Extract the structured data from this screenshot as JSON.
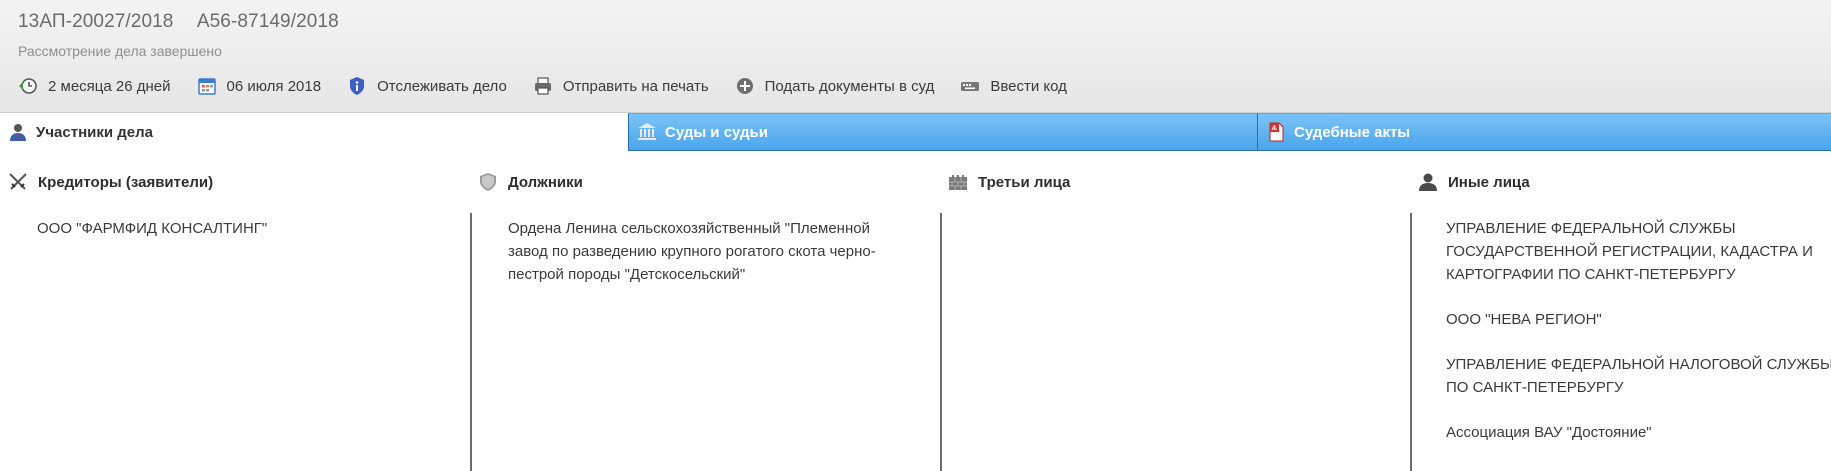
{
  "header": {
    "case_number": "13АП-20027/2018",
    "case_number_alt": "А56-87149/2018",
    "status": "Рассмотрение дела завершено"
  },
  "toolbar": {
    "duration": "2 месяца 26 дней",
    "date": "06 июля 2018",
    "track": "Отслеживать дело",
    "print": "Отправить на печать",
    "submit": "Подать документы в суд",
    "code": "Ввести код"
  },
  "tabs": {
    "participants": "Участники дела",
    "courts": "Суды и судьи",
    "acts": "Судебные акты"
  },
  "columns": {
    "creditors": {
      "title": "Кредиторы (заявители)",
      "items": [
        "ООО \"ФАРМФИД КОНСАЛТИНГ\""
      ]
    },
    "debtors": {
      "title": "Должники",
      "items": [
        "Ордена Ленина сельскохозяйственный \"Племенной завод по разведению крупного рогатого скота черно-пестрой породы \"Детскосельский\""
      ]
    },
    "third": {
      "title": "Третьи лица",
      "items": []
    },
    "others": {
      "title": "Иные лица",
      "items": [
        "УПРАВЛЕНИЕ ФЕДЕРАЛЬНОЙ СЛУЖБЫ ГОСУДАРСТВЕННОЙ РЕГИСТРАЦИИ, КАДАСТРА И КАРТОГРАФИИ ПО САНКТ-ПЕТЕРБУРГУ",
        "ООО \"НЕВА РЕГИОН\"",
        "УПРАВЛЕНИЕ ФЕДЕРАЛЬНОЙ НАЛОГОВОЙ СЛУЖБЫ ПО САНКТ-ПЕТЕРБУРГУ",
        "Ассоциация ВАУ \"Достояние\""
      ]
    }
  }
}
